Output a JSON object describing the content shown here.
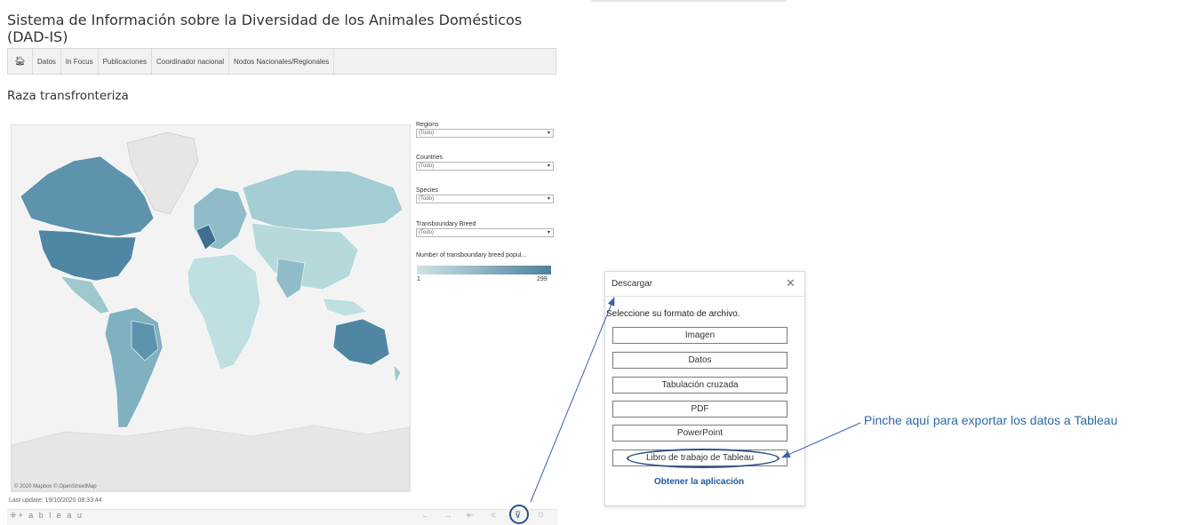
{
  "header": {
    "title": "Sistema de Información sobre la Diversidad de los Animales Domésticos (DAD-IS)"
  },
  "nav": {
    "home_icon": "home-icon",
    "items": [
      "Datos",
      "In Focus",
      "Publicaciones",
      "Coordinador nacional",
      "Nodos Nacionales/Regionales"
    ]
  },
  "section": {
    "title": "Raza transfronteriza"
  },
  "map": {
    "attribution": "© 2020 Mapbox © OpenStreetMap",
    "last_update": "Last update: 19/10/2020 08:33:44",
    "colors": {
      "low": "#cde5e6",
      "high": "#4d7f9c",
      "no_data": "#e6e6e6"
    }
  },
  "filters": [
    {
      "label": "Regions",
      "value": "(Todo)"
    },
    {
      "label": "Countries",
      "value": "(Todo)"
    },
    {
      "label": "Species",
      "value": "(Todo)"
    },
    {
      "label": "Transboundary Breed",
      "value": "(Todo)"
    }
  ],
  "legend": {
    "title": "Number of transboundary breed popul...",
    "min": "1",
    "max": "299"
  },
  "toolbar": {
    "logo": "⁜+ a b l e a u",
    "icons": [
      "undo-icon",
      "redo-icon",
      "revert-icon",
      "share-icon",
      "download-icon",
      "fullscreen-icon"
    ]
  },
  "dialog": {
    "title": "Descargar",
    "subtitle": "Seleccione su formato de archivo.",
    "buttons": [
      "Imagen",
      "Datos",
      "Tabulación cruzada",
      "PDF",
      "PowerPoint",
      "Libro de trabajo de Tableau"
    ],
    "get_app": "Obtener la aplicación"
  },
  "annotation": {
    "text": "Pinche aquí para exportar los datos a Tableau",
    "color": "#2c6aa6"
  }
}
